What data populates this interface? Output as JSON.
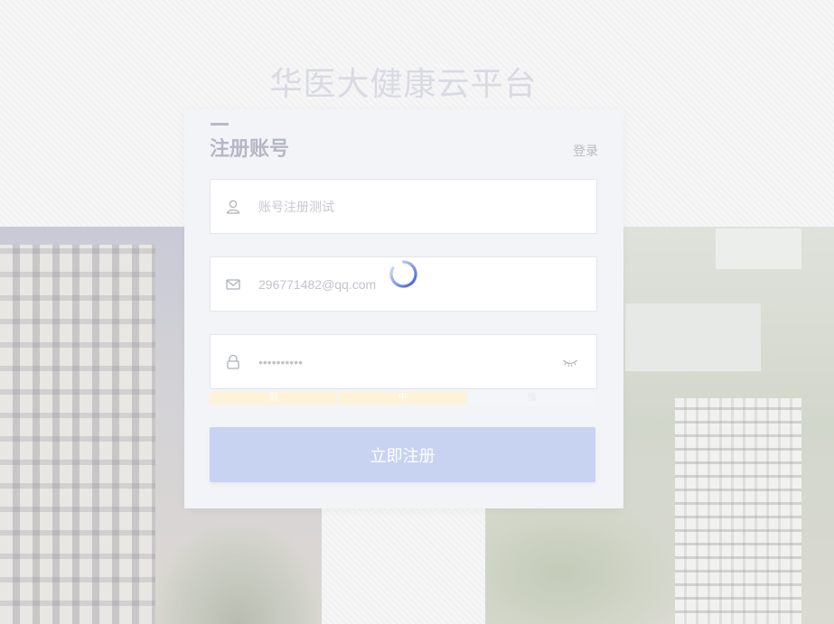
{
  "site_title": "华医大健康云平台",
  "card": {
    "title": "注册账号",
    "login_link": "登录"
  },
  "fields": {
    "username": {
      "icon": "user-icon",
      "value": "",
      "placeholder": "账号注册测试"
    },
    "email": {
      "icon": "mail-icon",
      "value": "296771482@qq.com",
      "placeholder": ""
    },
    "password": {
      "icon": "lock-icon",
      "value": "••••••••••",
      "placeholder": "",
      "toggle_icon": "eye-closed-icon"
    }
  },
  "strength": {
    "labels": [
      "弱",
      "中",
      "强"
    ],
    "level": 2,
    "active_color": "#fdf3d8"
  },
  "register_button": "立即注册",
  "loading_indicator": "spinner-icon",
  "colors": {
    "button": "#c8d3f1",
    "spinner": "#3b5bd6"
  }
}
